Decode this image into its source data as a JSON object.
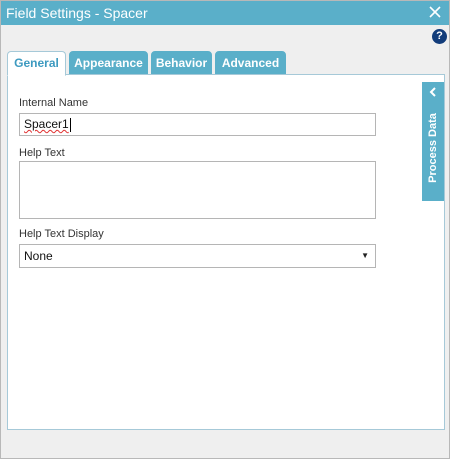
{
  "window": {
    "title": "Field Settings - Spacer"
  },
  "tabs": [
    {
      "label": "General",
      "active": true
    },
    {
      "label": "Appearance",
      "active": false
    },
    {
      "label": "Behavior",
      "active": false
    },
    {
      "label": "Advanced",
      "active": false
    }
  ],
  "form": {
    "internal_name": {
      "label": "Internal Name",
      "value": "Spacer1"
    },
    "help_text": {
      "label": "Help Text",
      "value": ""
    },
    "help_text_display": {
      "label": "Help Text Display",
      "value": "None"
    }
  },
  "side_panel": {
    "label": "Process Data"
  },
  "icons": {
    "close": "close-icon",
    "help": "help-icon",
    "collapse": "chevron-left-icon",
    "dropdown": "dropdown-arrow-icon"
  },
  "colors": {
    "accent": "#5aafc9",
    "active_tab_text": "#3d9ac0",
    "help_icon": "#123c7a"
  }
}
